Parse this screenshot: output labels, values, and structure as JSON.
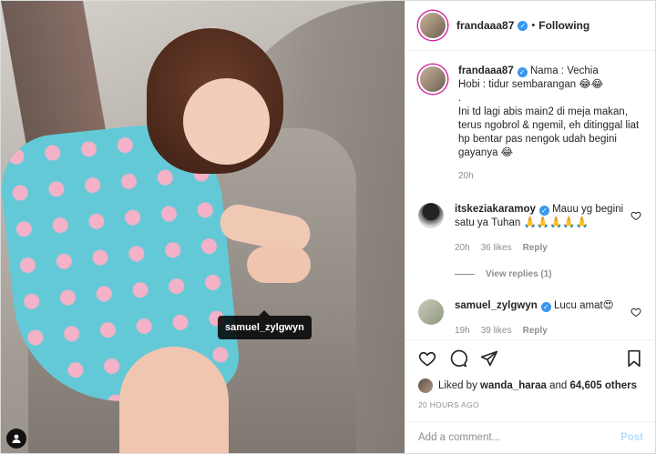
{
  "photo": {
    "tag_label": "samuel_zylgwyn"
  },
  "header": {
    "username": "frandaaa87",
    "separator": "•",
    "follow_status": "Following"
  },
  "caption": {
    "username": "frandaaa87",
    "line1": "Nama : Vechia",
    "line2": "Hobi : tidur sembarangan 😂😂",
    "line3": ".",
    "line4": "Ini td lagi abis main2 di meja makan, terus ngobrol & ngemil, eh ditinggal liat hp bentar pas nengok udah begini gayanya 😂",
    "time": "20h"
  },
  "comments": [
    {
      "username": "itskeziakaramoy",
      "text": "Mauu yg begini satu ya Tuhan 🙏🙏🙏🙏🙏",
      "time": "20h",
      "likes": "36 likes",
      "reply": "Reply",
      "view_replies": "View replies (1)"
    },
    {
      "username": "samuel_zylgwyn",
      "text": "Lucu amat😍",
      "time": "19h",
      "likes": "39 likes",
      "reply": "Reply"
    }
  ],
  "likes": {
    "prefix": "Liked by",
    "user": "wanda_haraa",
    "connector": "and",
    "others": "64,605 others"
  },
  "timestamp": "20 HOURS AGO",
  "composer": {
    "placeholder": "Add a comment...",
    "post_label": "Post"
  },
  "colors": {
    "link_blue": "#3897f0",
    "post_disabled": "#b2dffc",
    "muted": "#8e8e8e"
  }
}
